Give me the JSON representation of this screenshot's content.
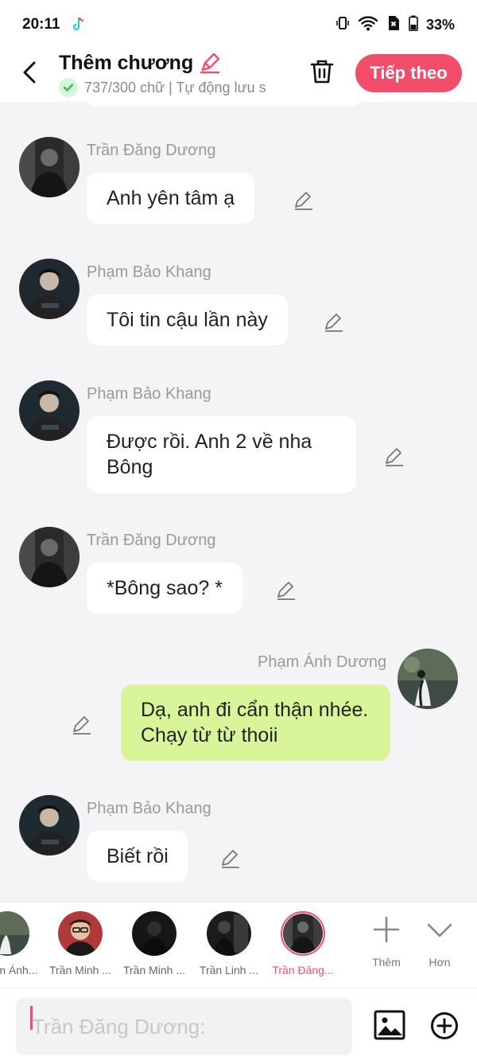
{
  "status": {
    "time": "20:11",
    "battery": "33%"
  },
  "header": {
    "title": "Thêm chương",
    "subtitle": "737/300 chữ | Tự động lưu s",
    "next_label": "Tiếp theo"
  },
  "messages": [
    {
      "sender": "Trần Đăng Dương",
      "text": "Anh yên tâm ạ",
      "mine": false
    },
    {
      "sender": "Phạm Bảo Khang",
      "text": "Tôi tin cậu lần này",
      "mine": false
    },
    {
      "sender": "Phạm Bảo Khang",
      "text": "Được rồi. Anh 2 về nha Bông",
      "mine": false
    },
    {
      "sender": "Trần Đăng Dương",
      "text": "*Bông sao? *",
      "mine": false
    },
    {
      "sender": "Phạm Ánh Dương",
      "text": "Dạ, anh đi cẩn thận nhée. Chạy từ từ thoii",
      "mine": true
    },
    {
      "sender": "Phạm Bảo Khang",
      "text": "Biết rồi",
      "mine": false
    }
  ],
  "characters": [
    {
      "name": "Phạm Ánh...",
      "selected": false
    },
    {
      "name": "Trần Minh ...",
      "selected": false
    },
    {
      "name": "Trần Minh ...",
      "selected": false
    },
    {
      "name": "Trần Linh ...",
      "selected": false
    },
    {
      "name": "Trần Đăng...",
      "selected": true
    }
  ],
  "char_actions": {
    "add_label": "Thêm",
    "more_label": "Hơn"
  },
  "composer": {
    "placeholder": "Trần Đăng Dương:"
  },
  "colors": {
    "accent": "#f24d6b",
    "my_bubble": "#d9f59a",
    "background": "#f4f4f6"
  }
}
